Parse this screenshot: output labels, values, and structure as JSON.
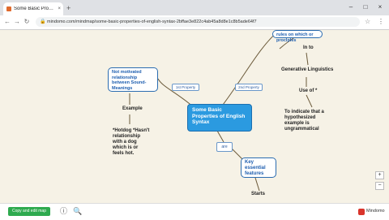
{
  "browser": {
    "tab_title": "Some Basic Properties of Englis",
    "tab_close": "×",
    "new_tab": "+",
    "url": "mindomo.com/mindmap/some-basic-properties-of-english-syntax-2bffae3e822c4ab45a8d8e1c8b5ade64f7",
    "controls": {
      "minimize": "–",
      "maximize": "□",
      "close": "×"
    },
    "nav": {
      "back": "←",
      "forward": "→",
      "reload": "↻",
      "star": "☆",
      "menu": "⋮",
      "lock": "🔒"
    }
  },
  "mindmap": {
    "main_node": "Some Basic Properties of English Syntax",
    "nodes": {
      "top_right": "rules on which or proclples",
      "not_motivated": "Not motivated relationship between Sound-Meanings",
      "key_features": "Key essential features"
    },
    "link_labels": {
      "first": "1st Property",
      "second": "2nd Property",
      "are": "are"
    },
    "plain": {
      "in_to": "In to",
      "generative": "Generative Linguistics",
      "use_of": "Use of *",
      "indicate": "To indicate that a hypothesized example is ungrammatical",
      "example": "Example",
      "hotdog": "*Hotdog *Hasn't relationship with a dog which is or feels hot.",
      "starts": "Starts"
    },
    "zoom": {
      "in": "+",
      "out": "−"
    }
  },
  "footer": {
    "copy_button": "Copy and edit map",
    "info_icon": "ⓘ",
    "search_icon": "🔍",
    "brand": "Mindomo"
  },
  "colors": {
    "background": "#f6f2e6",
    "node_border": "#2b6cb0",
    "main_node_fill": "#2b9ae0",
    "copy_button": "#2eaa4f"
  }
}
